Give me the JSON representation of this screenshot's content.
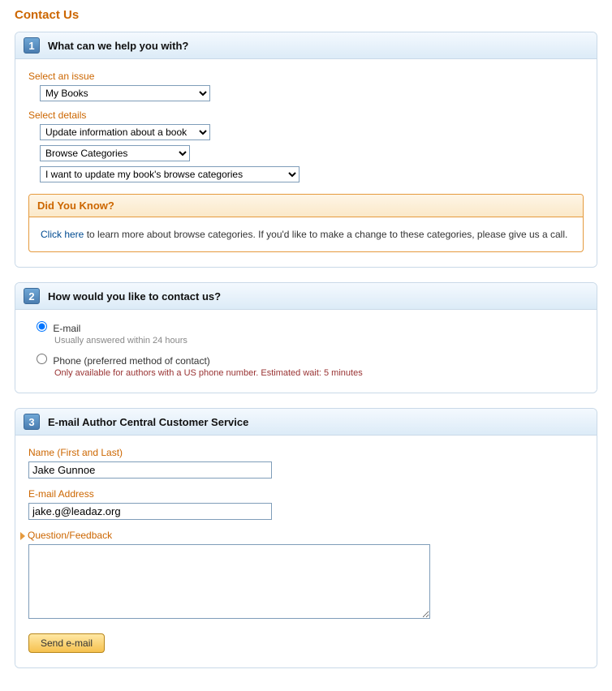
{
  "page_title": "Contact Us",
  "section1": {
    "number": "1",
    "title": "What can we help you with?",
    "select_issue_label": "Select an issue",
    "select_issue_value": "My Books",
    "select_details_label": "Select details",
    "detail1_value": "Update information about a book",
    "detail2_value": "Browse Categories",
    "detail3_value": "I want to update my book's browse categories",
    "info_title": "Did You Know?",
    "info_link": "Click here",
    "info_text": " to learn more about browse categories. If you'd like to make a change to these categories, please give us a call."
  },
  "section2": {
    "number": "2",
    "title": "How would you like to contact us?",
    "email_label": "E-mail",
    "email_sub": "Usually answered within 24 hours",
    "phone_label": "Phone (preferred method of contact)",
    "phone_sub": "Only available for authors with a US phone number. Estimated wait: 5 minutes"
  },
  "section3": {
    "number": "3",
    "title": "E-mail Author Central Customer Service",
    "name_label": "Name (First and Last)",
    "name_value": "Jake Gunnoe",
    "email_label": "E-mail Address",
    "email_value": "jake.g@leadaz.org",
    "question_label": "Question/Feedback",
    "question_value": "",
    "submit_label": "Send e-mail"
  }
}
